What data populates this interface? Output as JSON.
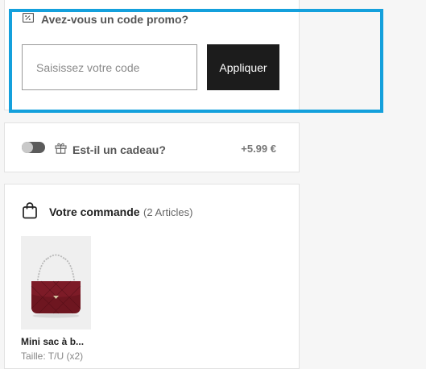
{
  "promo": {
    "title": "Avez-vous un code promo?",
    "input_placeholder": "Saisissez votre code",
    "apply_label": "Appliquer"
  },
  "gift": {
    "label": "Est-il un cadeau?",
    "price": "+5.99 €",
    "toggle_on": false
  },
  "order": {
    "title": "Votre commande",
    "count": "(2 Articles)",
    "items": [
      {
        "name": "Mini sac à b...",
        "size": "Taille: T/U (x2)"
      }
    ]
  },
  "colors": {
    "highlight": "#14a0dc",
    "button_bg": "#1c1c1c"
  },
  "icons": [
    "coupon-icon",
    "gift-icon",
    "shopping-bag-icon"
  ]
}
